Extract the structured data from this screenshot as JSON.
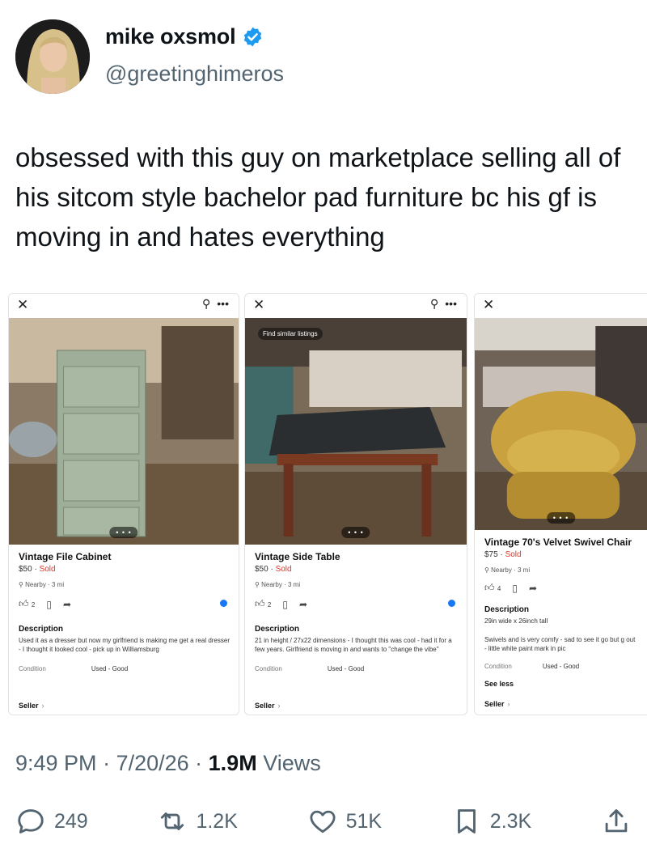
{
  "author": {
    "name": "mike oxsmol",
    "handle": "@greetinghimeros"
  },
  "tweet": {
    "text": "obsessed with this guy on marketplace selling all of his sitcom style bachelor pad furniture bc his gf is moving in and hates everything"
  },
  "listings": [
    {
      "title": "Vintage File Cabinet",
      "price": "$50",
      "status": "Sold",
      "location": "Nearby · 3 mi",
      "likes": "2",
      "description_label": "Description",
      "description": "Used it as a dresser but now my girlfriend is making me get a real dresser - I thought it looked cool - pick up in Williamsburg",
      "condition_label": "Condition",
      "condition": "Used - Good",
      "seller_label": "Seller"
    },
    {
      "title": "Vintage Side Table",
      "price": "$50",
      "status": "Sold",
      "location": "Nearby · 3 mi",
      "likes": "2",
      "find_similar": "Find similar listings",
      "description_label": "Description",
      "description": "21 in height / 27x22 dimensions - I thought this was cool - had it for a few years. Girlfriend is moving in and wants to \"change the vibe\"",
      "condition_label": "Condition",
      "condition": "Used - Good",
      "seller_label": "Seller"
    },
    {
      "title": "Vintage 70's Velvet Swivel Chair",
      "price": "$75",
      "status": "Sold",
      "location": "Nearby · 3 mi",
      "likes": "4",
      "description_label": "Description",
      "dimensions": "29in wide x 26inch tall",
      "description": "Swivels and is very comfy - sad to see it go but g out - little white paint mark in pic",
      "condition_label": "Condition",
      "condition": "Used - Good",
      "see_less": "See less",
      "seller_label": "Seller"
    }
  ],
  "meta": {
    "time": "9:49 PM",
    "date": "7/20/26",
    "views_count": "1.9M",
    "views_label": "Views"
  },
  "stats": {
    "replies": "249",
    "reposts": "1.2K",
    "likes": "51K",
    "bookmarks": "2.3K"
  },
  "colors": {
    "verified": "#1d9bf0",
    "sold": "#d33a2f",
    "secondary_text": "#536471"
  }
}
